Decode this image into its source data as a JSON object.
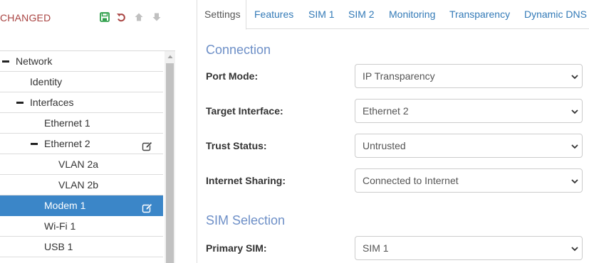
{
  "status": {
    "text": "CHANGED"
  },
  "toolbar": {
    "save_icon": "save-icon",
    "revert_icon": "undo-icon",
    "move_up_icon": "arrow-up-icon",
    "move_down_icon": "arrow-down-icon",
    "colors": {
      "save": "#2e9e4a",
      "revert": "#a94442",
      "disabled": "#c0c0c0",
      "status_text": "#a94442"
    }
  },
  "tree": {
    "items": [
      {
        "label": "Network",
        "expanded": true,
        "editable": false,
        "selected": false
      },
      {
        "label": "Identity",
        "expanded": false,
        "editable": false,
        "selected": false
      },
      {
        "label": "Interfaces",
        "expanded": true,
        "editable": false,
        "selected": false
      },
      {
        "label": "Ethernet 1",
        "expanded": false,
        "editable": false,
        "selected": false
      },
      {
        "label": "Ethernet 2",
        "expanded": true,
        "editable": true,
        "selected": false
      },
      {
        "label": "VLAN 2a",
        "expanded": false,
        "editable": false,
        "selected": false
      },
      {
        "label": "VLAN 2b",
        "expanded": false,
        "editable": false,
        "selected": false
      },
      {
        "label": "Modem 1",
        "expanded": false,
        "editable": true,
        "selected": true
      },
      {
        "label": "Wi-Fi 1",
        "expanded": false,
        "editable": false,
        "selected": false
      },
      {
        "label": "USB 1",
        "expanded": false,
        "editable": false,
        "selected": false
      }
    ],
    "selected_color": "#3b86c8"
  },
  "tabs": [
    {
      "label": "Settings",
      "active": true
    },
    {
      "label": "Features",
      "active": false
    },
    {
      "label": "SIM 1",
      "active": false
    },
    {
      "label": "SIM 2",
      "active": false
    },
    {
      "label": "Monitoring",
      "active": false
    },
    {
      "label": "Transparency",
      "active": false
    },
    {
      "label": "Dynamic DNS",
      "active": false
    }
  ],
  "connection": {
    "title": "Connection",
    "fields": [
      {
        "label": "Port Mode:",
        "value": "IP Transparency"
      },
      {
        "label": "Target Interface:",
        "value": "Ethernet 2"
      },
      {
        "label": "Trust Status:",
        "value": "Untrusted"
      },
      {
        "label": "Internet Sharing:",
        "value": "Connected to Internet"
      }
    ]
  },
  "sim_selection": {
    "title": "SIM Selection",
    "fields": [
      {
        "label": "Primary SIM:",
        "value": "SIM 1"
      }
    ]
  },
  "colors": {
    "link": "#337ab7",
    "section_title": "#6d8fc7"
  }
}
